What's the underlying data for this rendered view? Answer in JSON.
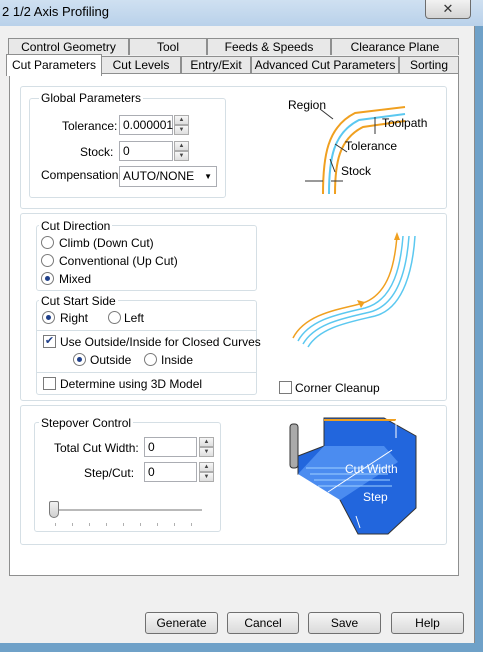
{
  "window": {
    "title": "2 1/2 Axis Profiling",
    "close_glyph": "✕"
  },
  "tabs_row1": [
    "Control Geometry",
    "Tool",
    "Feeds & Speeds",
    "Clearance Plane"
  ],
  "tabs_row2": [
    "Cut Parameters",
    "Cut Levels",
    "Entry/Exit",
    "Advanced Cut Parameters",
    "Sorting"
  ],
  "active_tab": "Cut Parameters",
  "global": {
    "legend": "Global Parameters",
    "tolerance_label": "Tolerance:",
    "tolerance_value": "0.000001",
    "stock_label": "Stock:",
    "stock_value": "0",
    "compensation_label": "Compensation:",
    "compensation_value": "AUTO/NONE",
    "diagram": {
      "region": "Region",
      "toolpath": "Toolpath",
      "tolerance": "Tolerance",
      "stock": "Stock"
    }
  },
  "cut_direction": {
    "legend": "Cut Direction",
    "options": [
      "Climb (Down Cut)",
      "Conventional (Up Cut)",
      "Mixed"
    ],
    "selected": "Mixed"
  },
  "cut_start": {
    "legend": "Cut Start Side",
    "right": "Right",
    "left": "Left",
    "selected": "Right",
    "use_outside_inside": "Use Outside/Inside for Closed Curves",
    "use_outside_inside_checked": true,
    "outside": "Outside",
    "inside": "Inside",
    "side_selected": "Outside",
    "determine_3d": "Determine using 3D Model",
    "determine_3d_checked": false
  },
  "corner_cleanup": {
    "label": "Corner Cleanup",
    "checked": false
  },
  "stepover": {
    "legend": "Stepover Control",
    "total_label": "Total Cut Width:",
    "total_value": "0",
    "step_label": "Step/Cut:",
    "step_value": "0",
    "slider_level": 0,
    "diagram": {
      "cut_width": "Cut Width",
      "step": "Step"
    }
  },
  "buttons": {
    "generate": "Generate",
    "cancel": "Cancel",
    "save": "Save",
    "help": "Help"
  },
  "colors": {
    "titlebar": "#b9d1ea",
    "accent_orange": "#f0a020",
    "toolpath_cyan": "#5bc8f0",
    "block_blue": "#2266dd"
  }
}
